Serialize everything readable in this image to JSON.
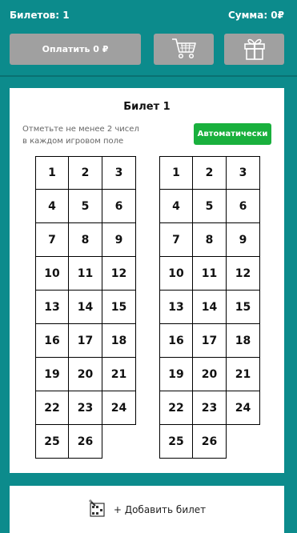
{
  "header": {
    "tickets_label": "Билетов: 1",
    "sum_label": "Сумма: 0₽"
  },
  "actions": {
    "pay_label": "Оплатить 0 ₽",
    "cart_icon": "cart-icon",
    "gift_icon": "gift-icon"
  },
  "ticket": {
    "title": "Билет 1",
    "hint_line1": "Отметьте не менее 2 чисел",
    "hint_line2": "в каждом игровом поле",
    "auto_label": "Автоматически",
    "fields": [
      {
        "numbers": [
          "1",
          "2",
          "3",
          "4",
          "5",
          "6",
          "7",
          "8",
          "9",
          "10",
          "11",
          "12",
          "13",
          "14",
          "15",
          "16",
          "17",
          "18",
          "19",
          "20",
          "21",
          "22",
          "23",
          "24",
          "25",
          "26"
        ]
      },
      {
        "numbers": [
          "1",
          "2",
          "3",
          "4",
          "5",
          "6",
          "7",
          "8",
          "9",
          "10",
          "11",
          "12",
          "13",
          "14",
          "15",
          "16",
          "17",
          "18",
          "19",
          "20",
          "21",
          "22",
          "23",
          "24",
          "25",
          "26"
        ]
      }
    ]
  },
  "footer": {
    "add_label": "+ Добавить билет",
    "add_icon": "lottery-ticket-icon"
  },
  "colors": {
    "background": "#0c8b8c",
    "button_gray": "#a0a0a0",
    "auto_green": "#19b03d"
  }
}
